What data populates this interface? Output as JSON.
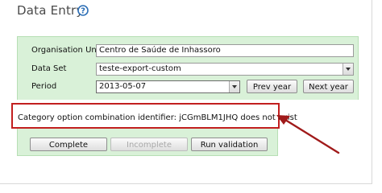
{
  "header": {
    "title": "Data Entry",
    "help_icon": "question-circle-icon"
  },
  "form": {
    "org_unit": {
      "label": "Organisation Unit",
      "value": "Centro de Saúde de Inhassoro"
    },
    "data_set": {
      "label": "Data Set",
      "value": "teste-export-custom"
    },
    "period": {
      "label": "Period",
      "value": "2013-05-07",
      "prev_label": "Prev year",
      "next_label": "Next year"
    }
  },
  "error": {
    "message": "Category option combination identifier: jCGmBLM1JHQ does not exist"
  },
  "actions": {
    "complete": "Complete",
    "incomplete": "Incomplete",
    "run_validation": "Run validation"
  },
  "colors": {
    "panel": "#d9f1d8",
    "error_border": "#c21f1f",
    "arrow": "#a01a1a"
  }
}
